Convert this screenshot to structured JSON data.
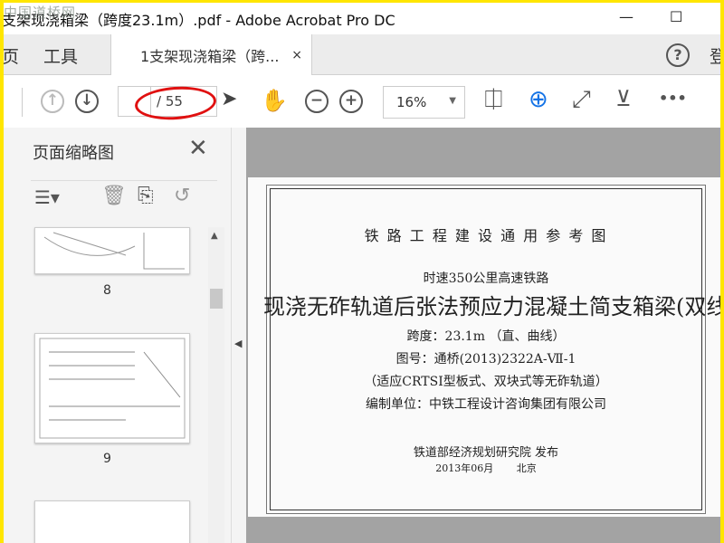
{
  "watermark": "中国道桥网",
  "window": {
    "title": "支架现浇箱梁（跨度23.1m）.pdf - Adobe Acrobat Pro DC",
    "minimize": "—",
    "maximize": "☐"
  },
  "tabs": {
    "home": "页",
    "tools": "工具",
    "document": "1支架现浇箱梁（跨...",
    "close": "×",
    "help": "?",
    "login": "登"
  },
  "toolbar": {
    "page_current": "",
    "page_total": "/ 55",
    "zoom": "16%",
    "more": "•••"
  },
  "panel": {
    "title": "页面缩略图",
    "close": "✕",
    "thumbnails": [
      {
        "label": "8"
      },
      {
        "label": "9"
      },
      {
        "label": ""
      }
    ]
  },
  "document": {
    "header": "铁 路 工 程 建 设 通 用 参 考 图",
    "subtitle": "时速350公里高速铁路",
    "title": "现浇无砟轨道后张法预应力混凝土简支箱梁(双线)",
    "span": "跨度：23.1m （直、曲线）",
    "drawing_no": "图号：通桥(2013)2322A-Ⅶ-1",
    "applicable": "（适应CRTSⅠ型板式、双块式等无砟轨道）",
    "compiler": "编制单位：中铁工程设计咨询集团有限公司",
    "publisher": "铁道部经济规划研究院 发布",
    "date_place": "2013年06月 　　北京"
  },
  "colors": {
    "annotation": "#e01010",
    "accent": "#1473e6",
    "border": "#ffe600"
  }
}
